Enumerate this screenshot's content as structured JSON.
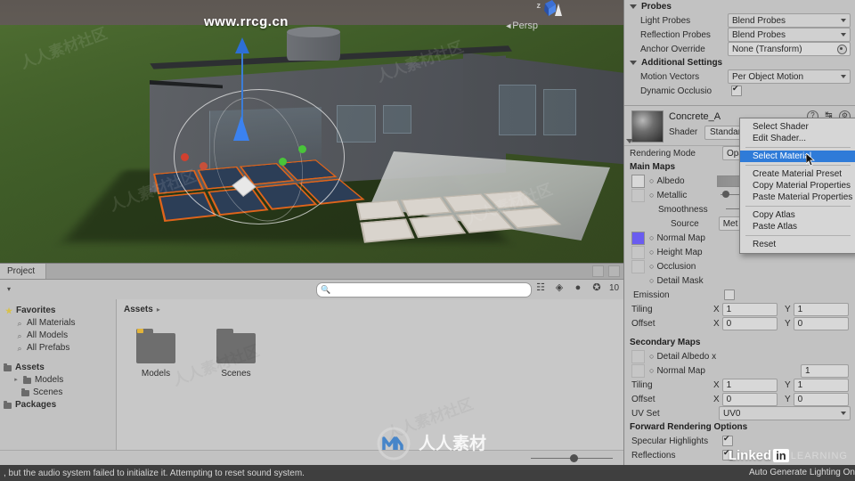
{
  "scene": {
    "view_label": "Persp",
    "axis_label_z": "z",
    "watermark": "www.rrcg.cn"
  },
  "inspector": {
    "probes": {
      "header": "Probes",
      "rows": [
        {
          "label": "Light Probes",
          "value": "Blend Probes",
          "type": "dropdown"
        },
        {
          "label": "Reflection Probes",
          "value": "Blend Probes",
          "type": "dropdown"
        },
        {
          "label": "Anchor Override",
          "value": "None (Transform)",
          "type": "object"
        }
      ]
    },
    "additional_settings": {
      "header": "Additional Settings",
      "rows": [
        {
          "label": "Motion Vectors",
          "value": "Per Object Motion",
          "type": "dropdown"
        },
        {
          "label": "Dynamic Occlusio",
          "value": "",
          "type": "checkbox",
          "checked": true
        }
      ]
    },
    "material": {
      "name": "Concrete_A",
      "shader_label": "Shader",
      "shader_value": "Standard",
      "icons": [
        "help-icon",
        "preset-icon",
        "gear-icon"
      ],
      "rendering_mode_label": "Rendering Mode",
      "rendering_mode_value": "Opa",
      "main_maps_header": "Main Maps",
      "main_maps": [
        {
          "label": "Albedo",
          "swatch": "white"
        },
        {
          "label": "Metallic",
          "swatch": "blank"
        },
        {
          "label": "Smoothness",
          "swatch": "none"
        },
        {
          "label": "Source",
          "swatch": "none",
          "value": "Met"
        },
        {
          "label": "Normal Map",
          "swatch": "normal"
        },
        {
          "label": "Height Map",
          "swatch": "blank"
        },
        {
          "label": "Occlusion",
          "swatch": "blank"
        },
        {
          "label": "Detail Mask",
          "swatch": "none"
        }
      ],
      "emission_label": "Emission",
      "emission_checked": false,
      "tiling_label": "Tiling",
      "offset_label": "Offset",
      "axis_x": "X",
      "axis_y": "Y",
      "main_tiling": {
        "x": "1",
        "y": "1"
      },
      "main_offset": {
        "x": "0",
        "y": "0"
      },
      "secondary_maps_header": "Secondary Maps",
      "secondary_maps": [
        {
          "label": "Detail Albedo x",
          "swatch": "blank"
        },
        {
          "label": "Normal Map",
          "swatch": "blank",
          "value": "1"
        }
      ],
      "secondary_tiling": {
        "x": "1",
        "y": "1"
      },
      "secondary_offset": {
        "x": "0",
        "y": "0"
      },
      "uv_set_label": "UV Set",
      "uv_set_value": "UV0",
      "forward_header": "Forward Rendering Options",
      "specular_label": "Specular Highlights",
      "specular_checked": true,
      "reflections_label": "Reflections",
      "reflections_checked": true
    }
  },
  "context_menu": {
    "items": [
      {
        "label": "Select Shader",
        "highlighted": false,
        "separator_after": false
      },
      {
        "label": "Edit Shader...",
        "highlighted": false,
        "separator_after": true
      },
      {
        "label": "Select Material",
        "highlighted": true,
        "separator_after": true
      },
      {
        "label": "Create Material Preset",
        "highlighted": false,
        "separator_after": false
      },
      {
        "label": "Copy Material Properties",
        "highlighted": false,
        "separator_after": false
      },
      {
        "label": "Paste Material Properties",
        "highlighted": false,
        "separator_after": true
      },
      {
        "label": "Copy Atlas",
        "highlighted": false,
        "separator_after": false
      },
      {
        "label": "Paste Atlas",
        "highlighted": false,
        "separator_after": true
      },
      {
        "label": "Reset",
        "highlighted": false,
        "separator_after": false
      }
    ]
  },
  "project": {
    "tab_label": "Project",
    "search_placeholder": "",
    "search_value": "",
    "toolbar_count": "10",
    "tree": {
      "favorites_header": "Favorites",
      "favorites": [
        "All Materials",
        "All Models",
        "All Prefabs"
      ],
      "assets_header": "Assets",
      "assets_children": [
        "Models",
        "Scenes"
      ],
      "packages_header": "Packages"
    },
    "breadcrumb": "Assets",
    "items": [
      {
        "label": "Models",
        "type": "folder",
        "selected": true
      },
      {
        "label": "Scenes",
        "type": "folder",
        "selected": false
      }
    ]
  },
  "statusbar": {
    "message": ", but the audio system failed to initialize it. Attempting to reset sound system.",
    "auto_generate": "Auto Generate Lighting On"
  },
  "branding": {
    "linkedin": "Linked",
    "linkedin_in": "in",
    "learning": "LEARNING"
  },
  "colors": {
    "panel_bg": "#c2c2c2",
    "scene_bg": "#5b5551",
    "accent_blue": "#2f7bd8",
    "status_bg": "#3f3f3f",
    "orange_outline": "#e0641a"
  }
}
